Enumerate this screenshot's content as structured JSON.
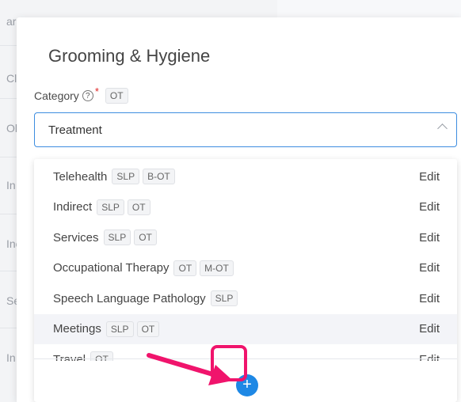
{
  "background": {
    "rows": [
      "arc",
      "Cli",
      "Oli",
      "In",
      "Inc",
      "Se",
      "In"
    ]
  },
  "modal": {
    "title": "Grooming & Hygiene",
    "category": {
      "label": "Category",
      "help_icon": "?",
      "required_mark": "*",
      "tag": "OT",
      "selected_value": "Treatment"
    },
    "options": [
      {
        "label": "Telehealth",
        "tags": [
          "SLP",
          "B-OT"
        ],
        "action": "Edit"
      },
      {
        "label": "Indirect",
        "tags": [
          "SLP",
          "OT"
        ],
        "action": "Edit"
      },
      {
        "label": "Services",
        "tags": [
          "SLP",
          "OT"
        ],
        "action": "Edit"
      },
      {
        "label": "Occupational Therapy",
        "tags": [
          "OT",
          "M-OT"
        ],
        "action": "Edit"
      },
      {
        "label": "Speech Language Pathology",
        "tags": [
          "SLP"
        ],
        "action": "Edit"
      },
      {
        "label": "Meetings",
        "tags": [
          "SLP",
          "OT"
        ],
        "action": "Edit"
      },
      {
        "label": "Travel",
        "tags": [
          "OT"
        ],
        "action": "Edit"
      }
    ],
    "add_button": "+"
  },
  "annotation": {
    "highlight_color": "#f0146c"
  }
}
